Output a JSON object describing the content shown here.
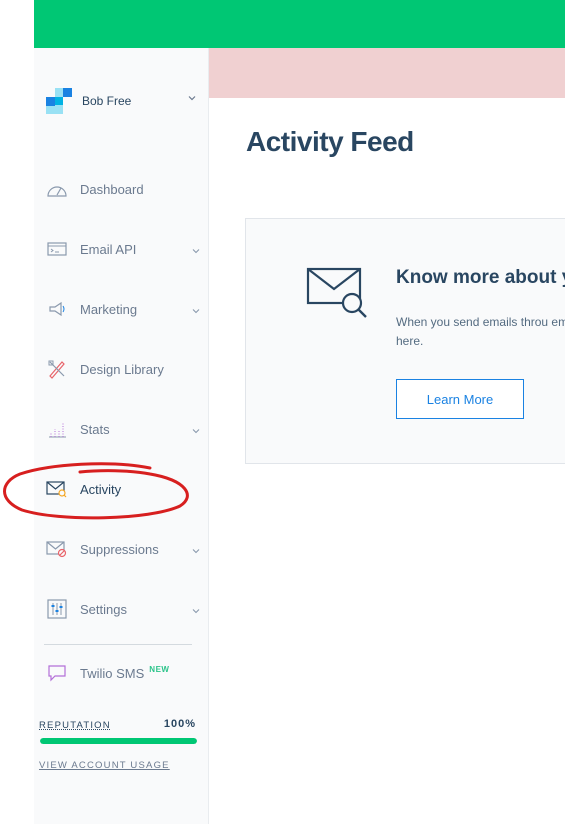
{
  "account": {
    "name": "Bob Free"
  },
  "sidebar": {
    "items": [
      {
        "label": "Dashboard",
        "icon": "dashboard-gauge-icon",
        "has_chevron": false
      },
      {
        "label": "Email API",
        "icon": "email-api-icon",
        "has_chevron": true
      },
      {
        "label": "Marketing",
        "icon": "megaphone-icon",
        "has_chevron": true
      },
      {
        "label": "Design Library",
        "icon": "design-pencil-icon",
        "has_chevron": false
      },
      {
        "label": "Stats",
        "icon": "stats-chart-icon",
        "has_chevron": true
      },
      {
        "label": "Activity",
        "icon": "activity-mail-search-icon",
        "has_chevron": false,
        "active": true
      },
      {
        "label": "Suppressions",
        "icon": "suppressions-mail-blocked-icon",
        "has_chevron": true
      },
      {
        "label": "Settings",
        "icon": "settings-sliders-icon",
        "has_chevron": true
      }
    ],
    "sms": {
      "label": "Twilio SMS",
      "badge": "NEW",
      "icon": "chat-bubble-icon"
    },
    "reputation": {
      "label": "REPUTATION",
      "value": "100%",
      "fraction": 1.0
    },
    "usage_link": "VIEW ACCOUNT USAGE"
  },
  "main": {
    "title": "Activity Feed",
    "card": {
      "heading": "Know more about y",
      "text": "When you send emails throu emails here.",
      "button": "Learn More",
      "icon": "mail-search-icon"
    }
  },
  "colors": {
    "topbar": "#00c774",
    "alert_band": "#f0d0d1",
    "accent": "#1a82e2",
    "text_dark": "#294661",
    "annotation": "#d71f1f"
  }
}
